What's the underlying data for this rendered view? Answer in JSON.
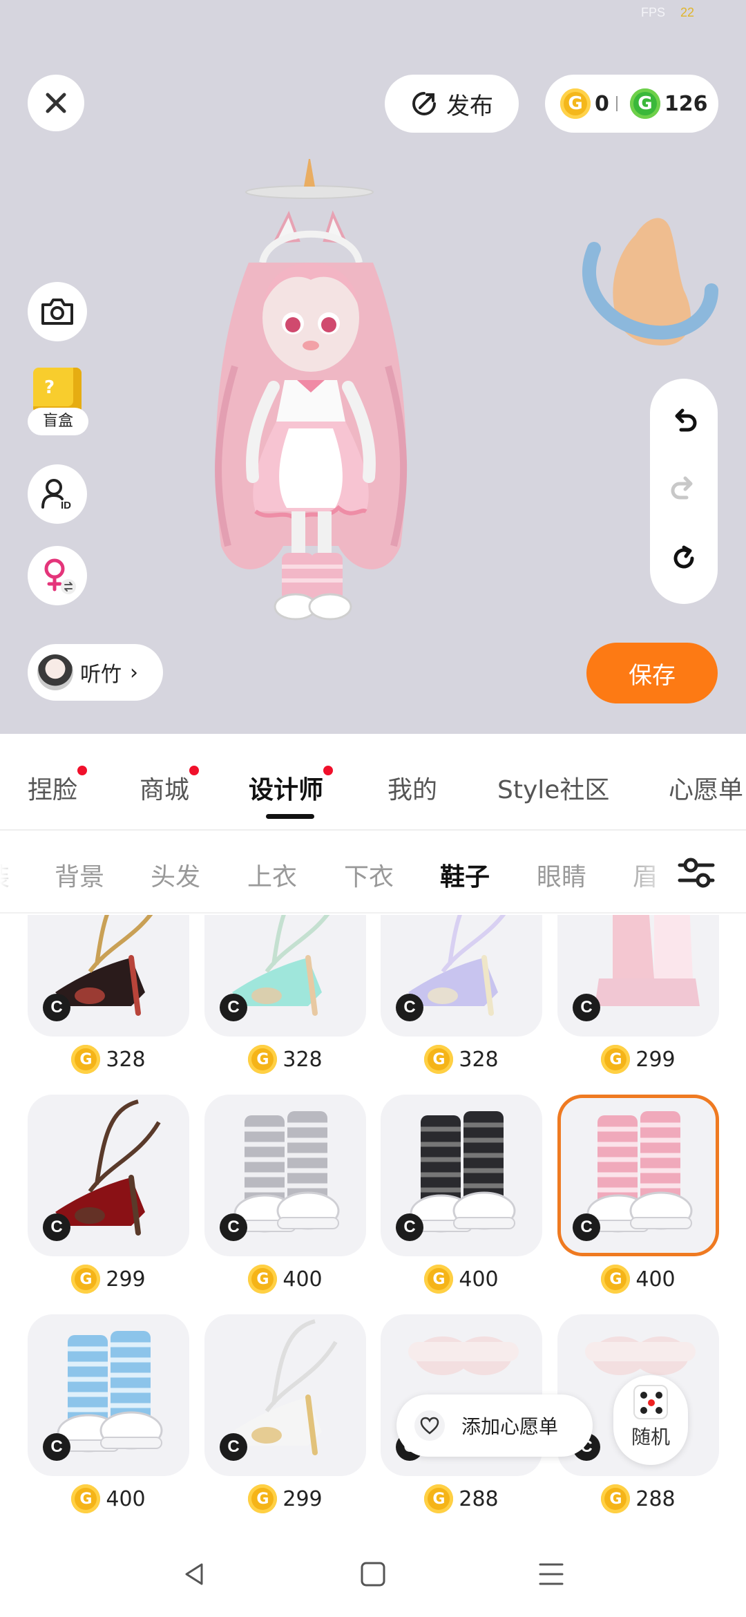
{
  "status": {
    "fps_label": "FPS",
    "fps_value": "22"
  },
  "header": {
    "publish_label": "发布",
    "coins": {
      "gold": "0",
      "green": "126",
      "gold_symbol": "G",
      "green_symbol": "G"
    }
  },
  "sidebar": {
    "blindbox_label": "盲盒",
    "blindbox_mark": "?"
  },
  "user": {
    "name": "听竹"
  },
  "save_label": "保存",
  "tabs": [
    {
      "label": "捏脸",
      "dot": true
    },
    {
      "label": "商城",
      "dot": true
    },
    {
      "label": "设计师",
      "dot": true,
      "active": true
    },
    {
      "label": "我的",
      "dot": false
    },
    {
      "label": "Style社区",
      "dot": false
    },
    {
      "label": "心愿单",
      "dot": false
    }
  ],
  "subtabs": [
    {
      "label": "装"
    },
    {
      "label": "背景"
    },
    {
      "label": "头发"
    },
    {
      "label": "上衣"
    },
    {
      "label": "下衣"
    },
    {
      "label": "鞋子",
      "active": true
    },
    {
      "label": "眼睛"
    },
    {
      "label": "眉"
    }
  ],
  "items": [
    {
      "price": "328",
      "style": "heel-dark",
      "badge": "C"
    },
    {
      "price": "328",
      "style": "heel-mint",
      "badge": "C"
    },
    {
      "price": "328",
      "style": "heel-lilac",
      "badge": "C"
    },
    {
      "price": "299",
      "style": "boot-pink",
      "badge": "C"
    },
    {
      "price": "299",
      "style": "heel-red",
      "badge": "C"
    },
    {
      "price": "400",
      "style": "sock-grey",
      "badge": "C"
    },
    {
      "price": "400",
      "style": "sock-black",
      "badge": "C"
    },
    {
      "price": "400",
      "style": "sock-pink",
      "badge": "C",
      "selected": true
    },
    {
      "price": "400",
      "style": "sock-blue",
      "badge": "C"
    },
    {
      "price": "299",
      "style": "heel-white",
      "badge": "C"
    },
    {
      "price": "288",
      "style": "sneaker-faded",
      "badge": "C"
    },
    {
      "price": "288",
      "style": "sneaker-faded",
      "badge": "C"
    }
  ],
  "price_coin_symbol": "G",
  "wishlist_label": "添加心愿单",
  "random_label": "随机",
  "colors": {
    "preview_bg": "#d6d5de",
    "save": "#fd7a14",
    "selected_border": "#ef7a21",
    "badge_dot": "#f0102b",
    "coin_gold": "#f5b418",
    "coin_green": "#3ab83a"
  }
}
